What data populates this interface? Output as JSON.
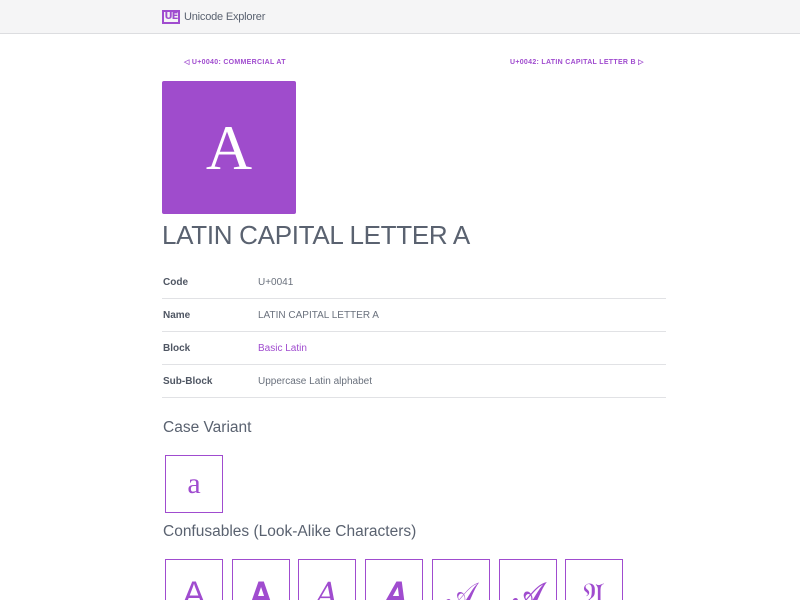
{
  "app": {
    "logo_text": "UE",
    "name": "Unicode Explorer"
  },
  "nav": {
    "prev": "◁ U+0040: COMMERCIAL AT",
    "next": "U+0042: LATIN CAPITAL LETTER B ▷"
  },
  "character": {
    "glyph": "A",
    "title": "LATIN CAPITAL LETTER A"
  },
  "properties": [
    {
      "key": "Code",
      "value": "U+0041"
    },
    {
      "key": "Name",
      "value": "LATIN CAPITAL LETTER A"
    },
    {
      "key": "Block",
      "value": "Basic Latin"
    },
    {
      "key": "Sub-Block",
      "value": "Uppercase Latin alphabet"
    }
  ],
  "case_variant": {
    "title": "Case Variant",
    "glyph": "a"
  },
  "confusables": {
    "title": "Confusables (Look-Alike Characters)",
    "glyphs": [
      "A",
      "𝐀",
      "𝐴",
      "𝑨",
      "𝒜",
      "𝓐",
      "𝔄"
    ]
  },
  "colors": {
    "accent": "#a04ccf",
    "tile": "#9f4ccc"
  }
}
